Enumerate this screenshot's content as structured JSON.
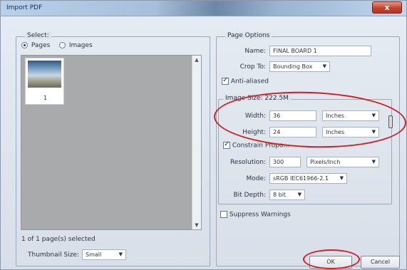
{
  "window": {
    "title": "Import PDF",
    "close_label": "x"
  },
  "select_group": {
    "label": "Select:",
    "radios": [
      {
        "label": "Pages",
        "checked": true
      },
      {
        "label": "Images",
        "checked": false
      }
    ],
    "thumbnails": [
      {
        "number": "1"
      }
    ],
    "status": "1 of 1 page(s) selected",
    "thumbnail_size_label": "Thumbnail Size:",
    "thumbnail_size_value": "Small"
  },
  "page_options": {
    "label": "Page Options",
    "name_label": "Name:",
    "name_value": "FINAL BOARD 1",
    "crop_label": "Crop To:",
    "crop_value": "Bounding Box",
    "anti_aliased_label": "Anti-aliased",
    "anti_aliased_checked": true,
    "image_size_label": "Image Size: 222.5M",
    "width_label": "Width:",
    "width_value": "36",
    "width_unit": "Inches",
    "height_label": "Height:",
    "height_value": "24",
    "height_unit": "Inches",
    "constrain_label": "Constrain Propo...",
    "constrain_checked": true,
    "resolution_label": "Resolution:",
    "resolution_value": "300",
    "resolution_unit": "Pixels/Inch",
    "mode_label": "Mode:",
    "mode_value": "sRGB IEC61966-2.1",
    "bitdepth_label": "Bit Depth:",
    "bitdepth_value": "8 bit"
  },
  "suppress_warnings": {
    "label": "Suppress Warnings",
    "checked": false
  },
  "buttons": {
    "ok": "OK",
    "cancel": "Cancel"
  },
  "annotations": {
    "color": "#d21f24"
  }
}
